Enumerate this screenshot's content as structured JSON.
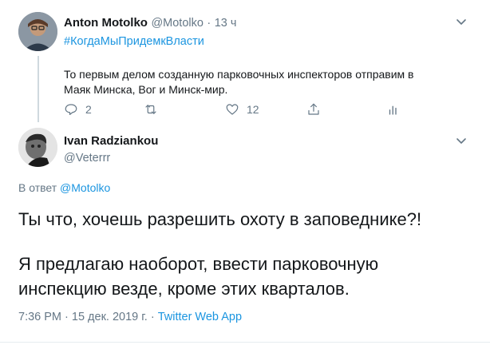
{
  "parent_tweet": {
    "author_name": "Anton Motolko",
    "handle": "@Motolko",
    "separator": "·",
    "time": "13 ч",
    "hashtag": "#КогдаМыПридемкВласти",
    "text_line1": "То первым делом созданную парковочных инспекторов отправим в",
    "text_line2": "Маяк Минска, Вог и Минск-мир.",
    "reply_count": "2",
    "like_count": "12"
  },
  "main_tweet": {
    "author_name": "Ivan Radziankou",
    "handle": "@Veterrr",
    "reply_to_prefix": "В ответ",
    "reply_to_handle": "@Motolko",
    "text_line1": "Ты что, хочешь разрешить охоту в заповеднике?!",
    "text_line2": "Я предлагаю наоборот, ввести парковочную",
    "text_line3": "инспекцию везде, кроме этих кварталов.",
    "meta_time": "7:36 PM · 15 дек. 2019 г. ·",
    "source_app": "Twitter Web App"
  },
  "icons": {
    "reply": "reply-icon",
    "retweet": "retweet-icon",
    "like": "heart-icon",
    "share": "share-icon",
    "analytics": "analytics-icon",
    "menu": "chevron-down-icon"
  },
  "colors": {
    "link": "#1b95e0",
    "muted": "#657786",
    "text": "#14171a"
  }
}
